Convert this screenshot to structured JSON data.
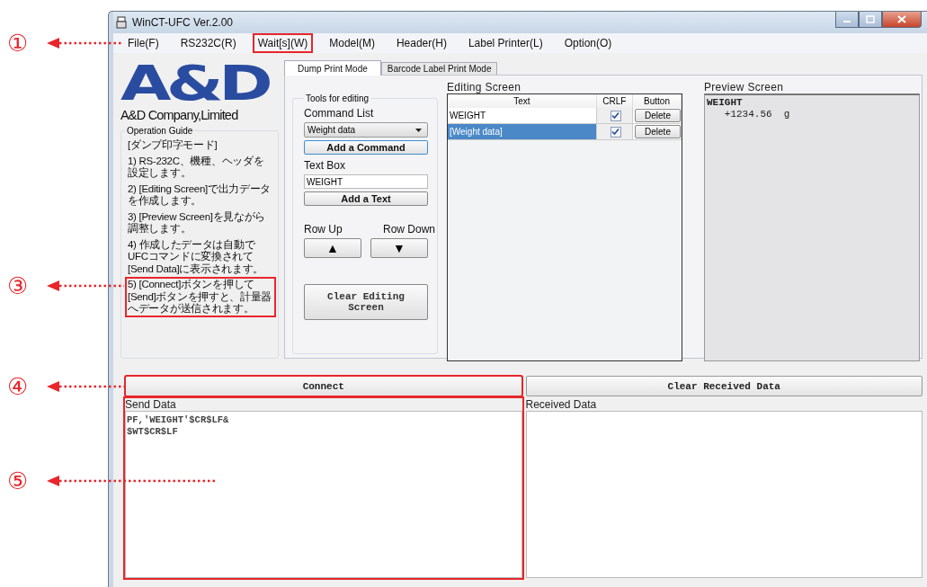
{
  "callouts": [
    {
      "number": "①"
    },
    {
      "number": "③"
    },
    {
      "number": "④"
    },
    {
      "number": "⑤"
    }
  ],
  "window": {
    "title": "WinCT-UFC  Ver.2.00"
  },
  "menu": [
    {
      "label": "File(F)",
      "highlighted": false
    },
    {
      "label": "RS232C(R)",
      "highlighted": false
    },
    {
      "label": "Wait[s](W)",
      "highlighted": true
    },
    {
      "label": "Model(M)",
      "highlighted": false
    },
    {
      "label": "Header(H)",
      "highlighted": false
    },
    {
      "label": "Label Printer(L)",
      "highlighted": false
    },
    {
      "label": "Option(O)",
      "highlighted": false
    }
  ],
  "logo": {
    "mark": "A&D",
    "company": "A&D Company,Limited"
  },
  "operation_guide": {
    "title": "Operation Guide",
    "heading": "[ダンプ印字モード]",
    "steps": [
      {
        "text": "1) RS-232C、機種、ヘッダを設定します。",
        "highlighted": false
      },
      {
        "text": "2) [Editing Screen]で出力データを作成します。",
        "highlighted": false
      },
      {
        "text": "3) [Preview Screen]を見ながら調整します。",
        "highlighted": false
      },
      {
        "text": "4) 作成したデータは自動でUFCコマンドに変換されて[Send Data]に表示されます。",
        "highlighted": false
      },
      {
        "text": "5) [Connect]ボタンを押して[Send]ボタンを押すと、計量器へデータが送信されます。",
        "highlighted": true
      }
    ]
  },
  "tabs": [
    {
      "label": "Dump Print Mode",
      "selected": true
    },
    {
      "label": "Barcode Label Print Mode",
      "selected": false
    }
  ],
  "tools": {
    "title": "Tools for editing",
    "command_list_label": "Command List",
    "command_value": "Weight data",
    "add_command": "Add a Command",
    "text_box_label": "Text Box",
    "text_box_value": "WEIGHT",
    "add_text": "Add a Text",
    "row_up_label": "Row Up",
    "row_down_label": "Row Down",
    "row_up": "▲",
    "row_down": "▼",
    "clear": "Clear Editing Screen"
  },
  "editing_screen": {
    "title": "Editing Screen",
    "columns": [
      "Text",
      "CRLF",
      "Button"
    ],
    "rows": [
      {
        "text": "WEIGHT",
        "crlf": true,
        "selected": false,
        "button": "Delete"
      },
      {
        "text": "[Weight data]",
        "crlf": true,
        "selected": true,
        "button": "Delete"
      }
    ]
  },
  "preview_screen": {
    "title": "Preview Screen",
    "lines": [
      {
        "text": "WEIGHT",
        "bold": true
      },
      {
        "text": "   +1234.56  g",
        "bold": false
      }
    ]
  },
  "connect": {
    "label": "Connect",
    "highlighted": true
  },
  "clear_received": {
    "label": "Clear Received Data"
  },
  "send_data": {
    "title": "Send Data",
    "lines": [
      "PF,'WEIGHT'$CR$LF&",
      "$WT$CR$LF"
    ],
    "highlighted": true
  },
  "received_data": {
    "title": "Received Data"
  }
}
